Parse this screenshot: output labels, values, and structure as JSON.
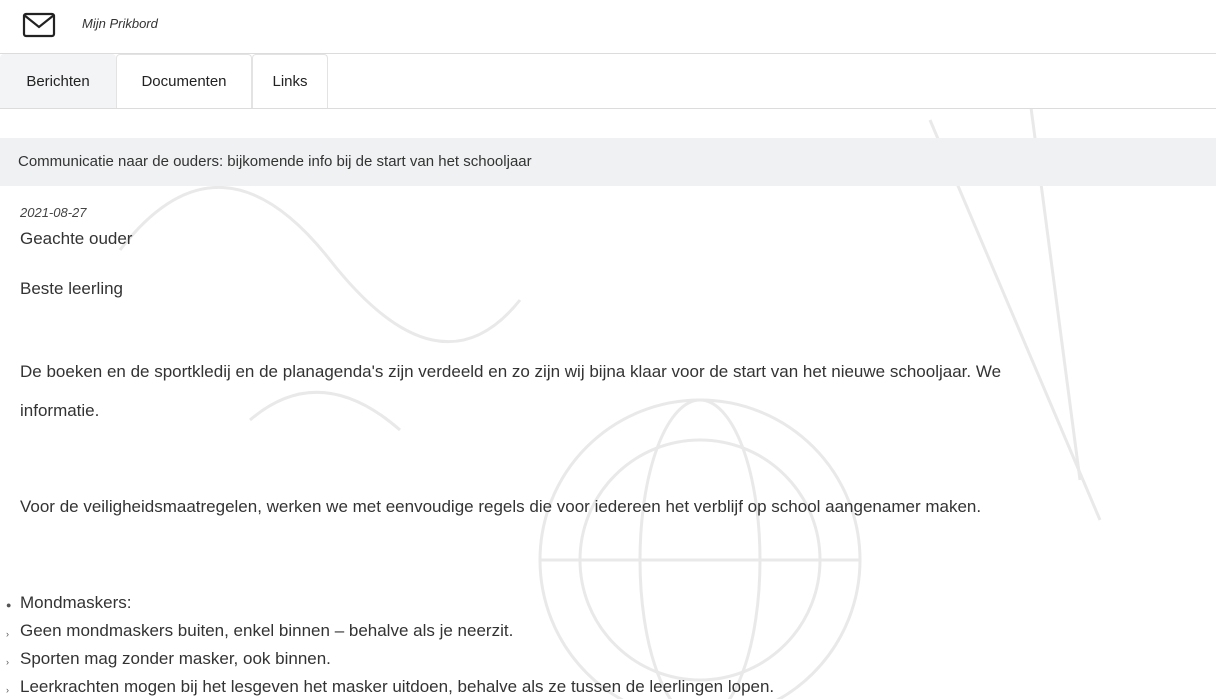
{
  "header": {
    "icon": "mail-icon",
    "title": "Mijn Prikbord"
  },
  "tabs": [
    {
      "label": "Berichten",
      "active": true
    },
    {
      "label": "Documenten",
      "active": false
    },
    {
      "label": "Links",
      "active": false
    }
  ],
  "message": {
    "subject": "Communicatie naar de ouders: bijkomende info bij de start van het schooljaar",
    "date": "2021-08-27",
    "greeting_1": "Geachte ouder",
    "greeting_2": "Beste leerling",
    "para_1_line_1": "De boeken en de sportkledij en de planagenda's zijn verdeeld en zo zijn wij bijna klaar voor de start van het nieuwe schooljaar. We",
    "para_1_line_2": "informatie.",
    "para_2": "Voor de veiligheidsmaatregelen, werken we met eenvoudige regels die voor iedereen het verblijf op school aangenamer maken.",
    "list": [
      "Mondmaskers:",
      "Geen mondmaskers buiten, enkel binnen – behalve als je neerzit.",
      "Sporten mag zonder masker, ook binnen.",
      "Leerkrachten mogen bij het lesgeven het masker uitdoen, behalve als ze tussen de leerlingen lopen."
    ]
  }
}
